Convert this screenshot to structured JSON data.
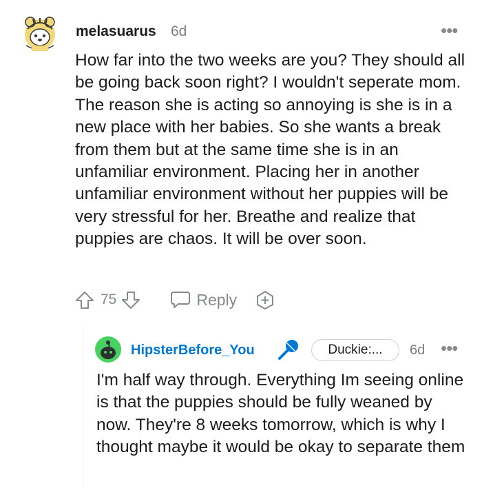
{
  "comment": {
    "author": "melasuarus",
    "timestamp": "6d",
    "more_label": "•••",
    "body": "How far into the two weeks are you? They should all be going back soon right? I wouldn't seperate mom. The reason she is acting so annoying is she is in a new place with her babies. So she wants a break from them but at the same time she is in an unfamiliar environment. Placing her in another unfamiliar environment without her puppies will be very stressful for her. Breathe and realize that puppies are chaos. It will be over soon.",
    "score": "75",
    "reply_label": "Reply",
    "avatar_icon": "tiger-costume-avatar-icon"
  },
  "reply": {
    "author": "HipsterBefore_You",
    "flair": "Duckie:...",
    "timestamp": "6d",
    "more_label": "•••",
    "body": "I'm half way through. Everything Im seeing online is that the puppies should be fully weaned by now. They're 8 weeks tomorrow, which is why I thought maybe it would be okay to separate them",
    "avatar_icon": "snoo-avatar-icon",
    "badge_icon": "microphone-icon"
  },
  "colors": {
    "username_link": "#0079d3",
    "meta_gray": "#878a8c",
    "text": "#1c1c1c",
    "avatar_bg": "#eaf4fb",
    "reply_avatar_green": "#46d160"
  }
}
